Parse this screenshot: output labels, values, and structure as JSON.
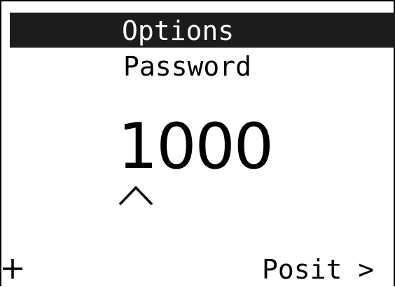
{
  "header": {
    "title": "Options"
  },
  "screen": {
    "subtitle": "Password",
    "value": "1000",
    "cursor_icon": "caret-up-icon"
  },
  "softkeys": {
    "left_icon": "plus-icon",
    "right_label": "Posit >"
  },
  "colors": {
    "background": "#ffffff",
    "header_background": "#1c1c1c",
    "header_text": "#ffffff",
    "text": "#000000"
  }
}
